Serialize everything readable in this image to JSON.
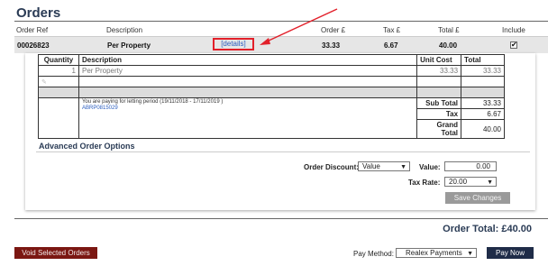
{
  "page": {
    "title": "Orders"
  },
  "columns": {
    "order_ref": "Order Ref",
    "description": "Description",
    "order_amount": "Order £",
    "tax": "Tax £",
    "total": "Total £",
    "include": "Include"
  },
  "order": {
    "ref": "00026823",
    "description": "Per Property",
    "details_link": "[details]",
    "order_amount": "33.33",
    "tax": "6.67",
    "total": "40.00",
    "include_checked": "✔"
  },
  "items_table": {
    "headers": {
      "quantity": "Quantity",
      "description": "Description",
      "unit_cost": "Unit Cost",
      "total": "Total"
    },
    "row": {
      "quantity": "1",
      "description": "Per Property",
      "unit_cost": "33.33",
      "total": "33.33"
    },
    "note_line1": "You are paying for letting period (19/11/2018 - 17/11/2019 )",
    "note_line2": "ABRP0815029",
    "subtotal_label": "Sub Total",
    "subtotal_value": "33.33",
    "tax_label": "Tax",
    "tax_value": "6.67",
    "grand_total_label": "Grand Total",
    "grand_total_value": "40.00"
  },
  "advanced": {
    "title": "Advanced Order Options",
    "discount_label": "Order Discount:",
    "discount_type": "Value",
    "value_label": "Value:",
    "value": "0.00",
    "tax_rate_label": "Tax Rate:",
    "tax_rate": "20.00",
    "save_label": "Save Changes"
  },
  "footer": {
    "order_total": "Order Total: £40.00",
    "void_label": "Void Selected Orders",
    "pay_method_label": "Pay Method:",
    "pay_method": "Realex Payments",
    "pay_now_label": "Pay Now"
  },
  "colors": {
    "heading": "#2a3b55",
    "highlight": "#e2202a",
    "void_button": "#7b1712",
    "pay_button": "#1f2c48",
    "save_button": "#9a9a9a"
  }
}
